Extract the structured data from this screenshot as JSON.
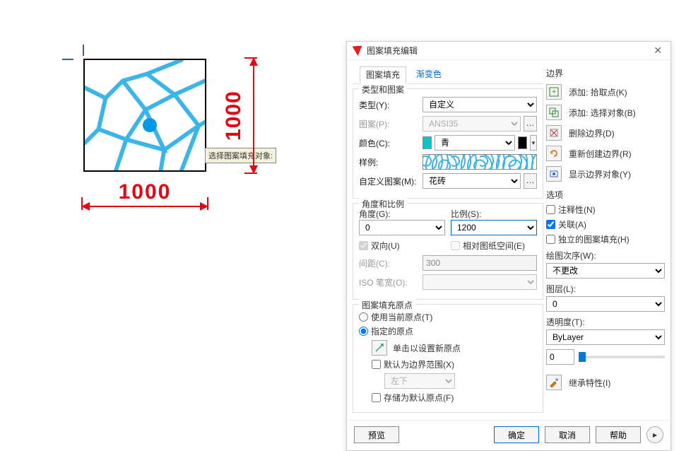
{
  "drawing": {
    "dim_h": "1000",
    "dim_v": "1000",
    "tooltip": "选择图案填充对象:"
  },
  "dialog": {
    "title": "图案填充编辑",
    "close": "✕",
    "tabs": {
      "hatch": "图案填充",
      "gradient": "渐变色"
    },
    "type_pattern": {
      "title": "类型和图案",
      "type_label": "类型(Y):",
      "type_value": "自定义",
      "pattern_label": "图案(P):",
      "pattern_value": "ANSI35",
      "color_label": "颜色(C):",
      "color_value": "青",
      "sample_label": "样例:",
      "custom_label": "自定义图案(M):",
      "custom_value": "花砖"
    },
    "angle_scale": {
      "title": "角度和比例",
      "angle_label": "角度(G):",
      "angle_value": "0",
      "scale_label": "比例(S):",
      "scale_value": "1200",
      "bidir_label": "双向(U)",
      "paper_label": "相对图纸空间(E)",
      "spacing_label": "间距(C):",
      "spacing_value": "300",
      "iso_label": "ISO 笔宽(O):"
    },
    "origin": {
      "title": "图案填充原点",
      "use_current": "使用当前原点(T)",
      "specified": "指定的原点",
      "click_new": "单击以设置新原点",
      "default_boundary": "默认为边界范围(X)",
      "position_value": "左下",
      "store_default": "存储为默认原点(F)"
    },
    "boundary": {
      "title": "边界",
      "add_pick": "添加: 拾取点(K)",
      "add_select": "添加: 选择对象(B)",
      "remove": "删除边界(D)",
      "recreate": "重新创建边界(R)",
      "show": "显示边界对象(Y)"
    },
    "options": {
      "title": "选项",
      "annotative": "注释性(N)",
      "associative": "关联(A)",
      "separate": "独立的图案填充(H)",
      "draw_order": "绘图次序(W):",
      "draw_order_value": "不更改",
      "layer": "图层(L):",
      "layer_value": "0",
      "transparency": "透明度(T):",
      "transparency_value": "ByLayer",
      "transparency_num": "0",
      "inherit": "继承特性(I)"
    },
    "footer": {
      "preview": "预览",
      "ok": "确定",
      "cancel": "取消",
      "help": "帮助"
    }
  }
}
